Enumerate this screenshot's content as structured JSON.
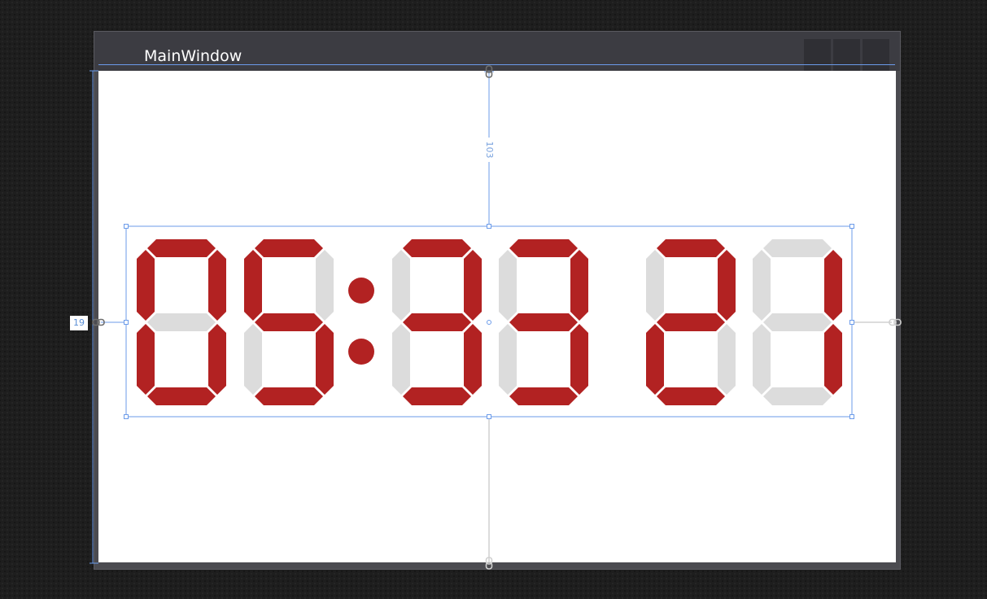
{
  "window": {
    "title": "MainWindow"
  },
  "clock": {
    "digits": [
      "0",
      "5",
      "3",
      "3",
      "2",
      "1"
    ],
    "separator": ":",
    "on_color": "#b22222",
    "off_color": "#dcdcdc"
  },
  "designer": {
    "left_margin": "19",
    "top_margin": "103",
    "guide_color": "#6b9bea"
  }
}
